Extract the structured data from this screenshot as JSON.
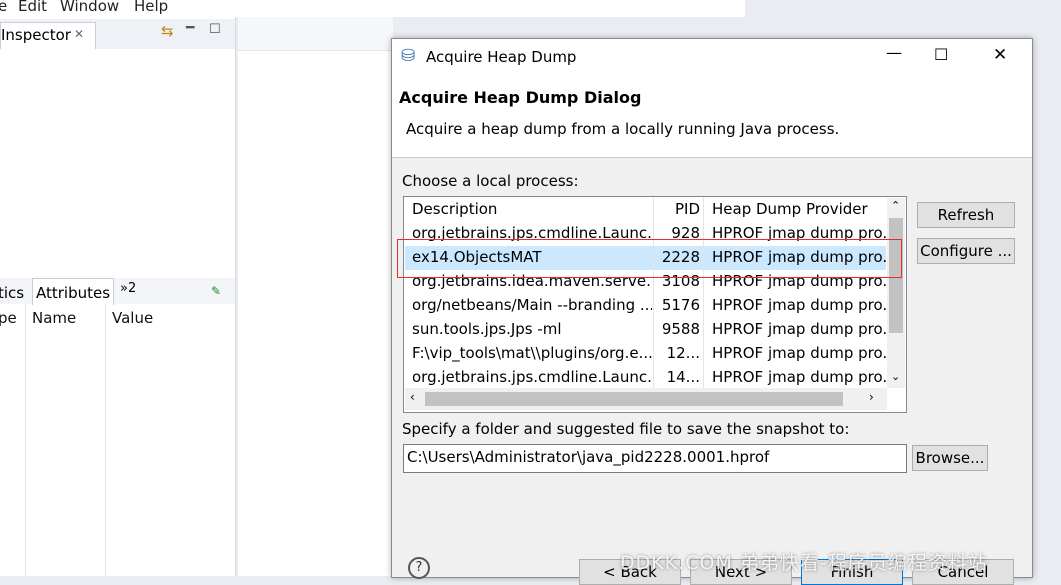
{
  "menubar": {
    "items": [
      "e",
      "Edit",
      "Window",
      "Help"
    ]
  },
  "inspector": {
    "tab_label": "Inspector"
  },
  "attributes_panel": {
    "tabs": [
      "tics",
      "Attributes",
      "»2"
    ],
    "columns": [
      "pe",
      "Name",
      "Value"
    ]
  },
  "dialog": {
    "title": "Acquire Heap Dump",
    "heading": "Acquire Heap Dump Dialog",
    "description": "Acquire a heap dump from a locally running Java process.",
    "choose_label": "Choose a local process:",
    "columns": [
      "Description",
      "PID",
      "Heap Dump Provider"
    ],
    "rows": [
      {
        "description": "org.jetbrains.jps.cmdline.Launc...",
        "pid": "928",
        "provider": "HPROF jmap dump pro..."
      },
      {
        "description": "ex14.ObjectsMAT",
        "pid": "2228",
        "provider": "HPROF jmap dump pro..."
      },
      {
        "description": "org.jetbrains.idea.maven.serve...",
        "pid": "3108",
        "provider": "HPROF jmap dump pro..."
      },
      {
        "description": "org/netbeans/Main --branding ...",
        "pid": "5176",
        "provider": "HPROF jmap dump pro..."
      },
      {
        "description": "sun.tools.jps.Jps -ml",
        "pid": "9588",
        "provider": "HPROF jmap dump pro..."
      },
      {
        "description": "F:\\vip_tools\\mat\\\\plugins/org.e...",
        "pid": "12...",
        "provider": "HPROF jmap dump pro..."
      },
      {
        "description": "org.jetbrains.jps.cmdline.Launc...",
        "pid": "14...",
        "provider": "HPROF jmap dump pro..."
      }
    ],
    "selected_row": 1,
    "refresh_label": "Refresh",
    "configure_label": "Configure ...",
    "save_label": "Specify a folder and suggested file to save the snapshot to:",
    "path_value": "C:\\Users\\Administrator\\java_pid2228.0001.hprof",
    "browse_label": "Browse...",
    "back_label": "< Back",
    "next_label": "Next >",
    "finish_label": "Finish",
    "cancel_label": "Cancel"
  },
  "watermark": "DDKK.COM 弟弟快看-程序员编程资料站",
  "colors": {
    "selection": "#cce8ff",
    "highlight_box": "#e03030",
    "dialog_bg": "#f0f0f0"
  }
}
